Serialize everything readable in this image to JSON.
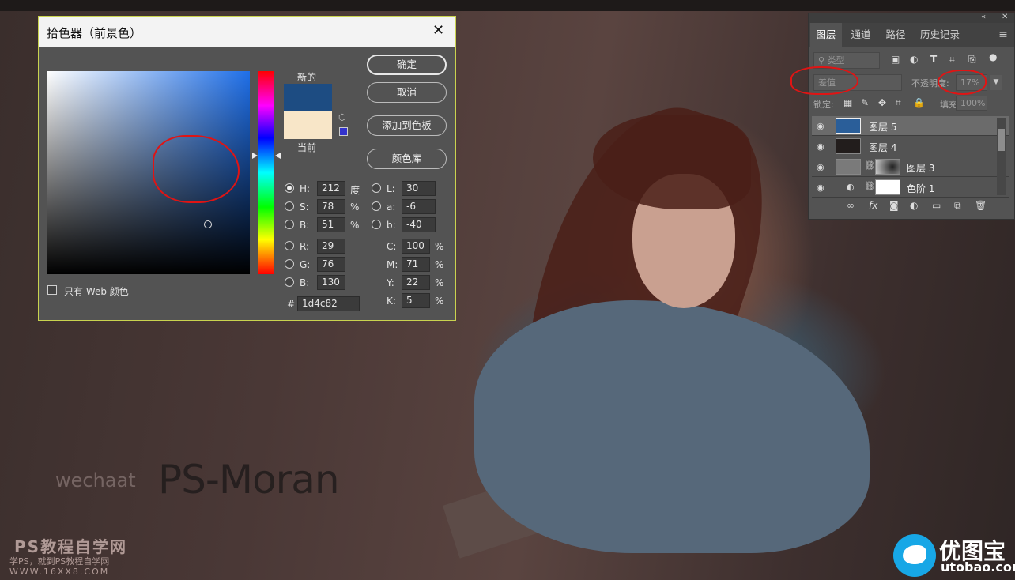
{
  "dialog": {
    "title": "拾色器（前景色）",
    "close_glyph": "✕",
    "new_label": "新的",
    "current_label": "当前",
    "new_color": "#1d4c82",
    "current_color": "#f8e6c8",
    "buttons": {
      "ok": "确定",
      "cancel": "取消",
      "add_swatch": "添加到色板",
      "color_library": "颜色库"
    },
    "fields": {
      "H": {
        "label": "H:",
        "value": "212",
        "unit": "度"
      },
      "S": {
        "label": "S:",
        "value": "78",
        "unit": "%"
      },
      "B": {
        "label": "B:",
        "value": "51",
        "unit": "%"
      },
      "R": {
        "label": "R:",
        "value": "29"
      },
      "G": {
        "label": "G:",
        "value": "76"
      },
      "Bl": {
        "label": "B:",
        "value": "130"
      },
      "L": {
        "label": "L:",
        "value": "30"
      },
      "a": {
        "label": "a:",
        "value": "-6"
      },
      "b": {
        "label": "b:",
        "value": "-40"
      },
      "C": {
        "label": "C:",
        "value": "100",
        "unit": "%"
      },
      "M": {
        "label": "M:",
        "value": "71",
        "unit": "%"
      },
      "Y": {
        "label": "Y:",
        "value": "22",
        "unit": "%"
      },
      "K": {
        "label": "K:",
        "value": "5",
        "unit": "%"
      },
      "hex": {
        "label": "#",
        "value": "1d4c82"
      }
    },
    "web_only_label": "只有 Web 颜色",
    "selected_radio": "H"
  },
  "layers_panel": {
    "collapse_glyph": "«",
    "close_glyph": "✕",
    "tabs": [
      "图层",
      "通道",
      "路径",
      "历史记录"
    ],
    "active_tab": "图层",
    "menu_glyph": "≡",
    "filter_placeholder": "类型",
    "blend_mode": "差值",
    "opacity_label": "不透明度:",
    "opacity_value": "17%",
    "lock_label": "锁定:",
    "fill_label": "填充:",
    "fill_value": "100%",
    "layers": [
      {
        "name": "图层 5",
        "selected": true,
        "thumb_color": "#2a5e99"
      },
      {
        "name": "图层 4",
        "selected": false,
        "thumb_color": "#221d1c"
      },
      {
        "name": "图层 3",
        "selected": false,
        "thumb_color": "#7a7a7a"
      },
      {
        "name": "色阶 1",
        "selected": false,
        "thumb_color": "#ffffff"
      }
    ],
    "footer_icons": [
      "link-icon",
      "fx-icon",
      "mask-icon",
      "adjustment-icon",
      "folder-icon",
      "new-layer-icon",
      "trash-icon"
    ],
    "footer_glyphs": {
      "link": "∞",
      "fx": "fx",
      "mask": "◙",
      "adjustment": "◐",
      "folder": "▭",
      "new_layer": "⧉",
      "trash": "🗑"
    }
  },
  "watermarks": {
    "wechaat": "wechaat",
    "psmoran": "PS-Moran",
    "ps_site": "PS教程自学网",
    "ps_slogan": "学PS，就到PS教程自学网",
    "ps_url": "WWW.16XX8.COM",
    "utobao_cn": "优图宝",
    "utobao_url": "utobao.com"
  },
  "colors": {
    "annotation_red": "#e01414",
    "dialog_border": "#c9d34f"
  }
}
